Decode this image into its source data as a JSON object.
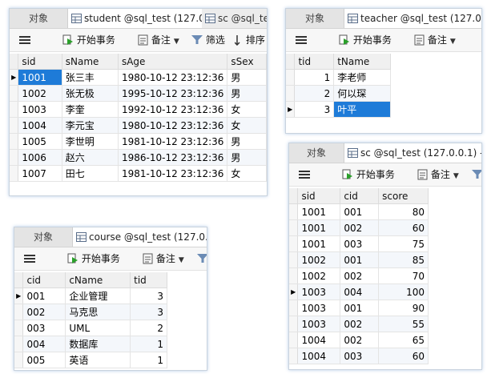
{
  "panel_student": {
    "tabs": [
      "对象",
      "student @sql_test (127.0....",
      "sc @sql_te"
    ],
    "toolbar": {
      "menu": "",
      "begin_tx": "开始事务",
      "note": "备注",
      "filter": "筛选",
      "sort": "排序"
    },
    "columns": [
      "sid",
      "sName",
      "sAge",
      "sSex"
    ],
    "rows": [
      [
        "1001",
        "张三丰",
        "1980-10-12 23:12:36",
        "男"
      ],
      [
        "1002",
        "张无极",
        "1995-10-12 23:12:36",
        "男"
      ],
      [
        "1003",
        "李奎",
        "1992-10-12 23:12:36",
        "女"
      ],
      [
        "1004",
        "李元宝",
        "1980-10-12 23:12:36",
        "女"
      ],
      [
        "1005",
        "李世明",
        "1981-10-12 23:12:36",
        "男"
      ],
      [
        "1006",
        "赵六",
        "1986-10-12 23:12:36",
        "男"
      ],
      [
        "1007",
        "田七",
        "1981-10-12 23:12:36",
        "女"
      ]
    ]
  },
  "panel_teacher": {
    "tabs": [
      "对象",
      "teacher @sql_test (127.0..."
    ],
    "toolbar": {
      "begin_tx": "开始事务",
      "note": "备注"
    },
    "columns": [
      "tid",
      "tName"
    ],
    "rows": [
      [
        "1",
        "李老师"
      ],
      [
        "2",
        "何以琛"
      ],
      [
        "3",
        "叶平"
      ]
    ]
  },
  "panel_sc": {
    "tabs": [
      "对象",
      "sc @sql_test (127.0.0.1) - ..."
    ],
    "toolbar": {
      "begin_tx": "开始事务",
      "note": "备注"
    },
    "columns": [
      "sid",
      "cid",
      "score"
    ],
    "rows": [
      [
        "1001",
        "001",
        "80"
      ],
      [
        "1001",
        "002",
        "60"
      ],
      [
        "1001",
        "003",
        "75"
      ],
      [
        "1002",
        "001",
        "85"
      ],
      [
        "1002",
        "002",
        "70"
      ],
      [
        "1003",
        "004",
        "100"
      ],
      [
        "1003",
        "001",
        "90"
      ],
      [
        "1003",
        "002",
        "55"
      ],
      [
        "1004",
        "002",
        "65"
      ],
      [
        "1004",
        "003",
        "60"
      ]
    ]
  },
  "panel_course": {
    "tabs": [
      "对象",
      "course @sql_test (127.0...."
    ],
    "toolbar": {
      "begin_tx": "开始事务",
      "note": "备注"
    },
    "columns": [
      "cid",
      "cName",
      "tid"
    ],
    "rows": [
      [
        "001",
        "企业管理",
        "3"
      ],
      [
        "002",
        "马克思",
        "3"
      ],
      [
        "003",
        "UML",
        "2"
      ],
      [
        "004",
        "数据库",
        "1"
      ],
      [
        "005",
        "英语",
        "1"
      ]
    ]
  }
}
